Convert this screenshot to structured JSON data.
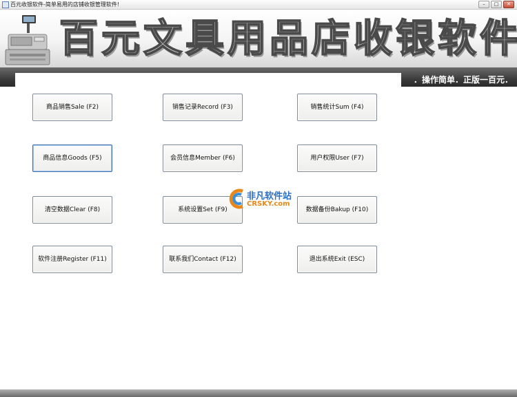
{
  "window": {
    "title": "百元收银软件-简单易用的店铺收银管理软件!",
    "controls": [
      "minimize",
      "maximize",
      "close"
    ]
  },
  "banner": {
    "title": "百元文具用品店收银软件",
    "slogan": "．操作简单．正版一百元．"
  },
  "buttons": [
    {
      "label": "商品销售Sale (F2)"
    },
    {
      "label": "销售记录Record (F3)"
    },
    {
      "label": "销售统计Sum (F4)"
    },
    {
      "label": "商品信息Goods (F5)"
    },
    {
      "label": "会员信息Member (F6)"
    },
    {
      "label": "用户权限User (F7)"
    },
    {
      "label": "清空数据Clear (F8)"
    },
    {
      "label": "系统设置Set (F9)"
    },
    {
      "label": "数据备份Bakup (F10)"
    },
    {
      "label": "软件注册Register (F11)"
    },
    {
      "label": "联系我们Contact (F12)"
    },
    {
      "label": "退出系统Exit (ESC)"
    }
  ],
  "watermark": {
    "cn": "非凡软件站",
    "en": "CRSKY.com"
  }
}
